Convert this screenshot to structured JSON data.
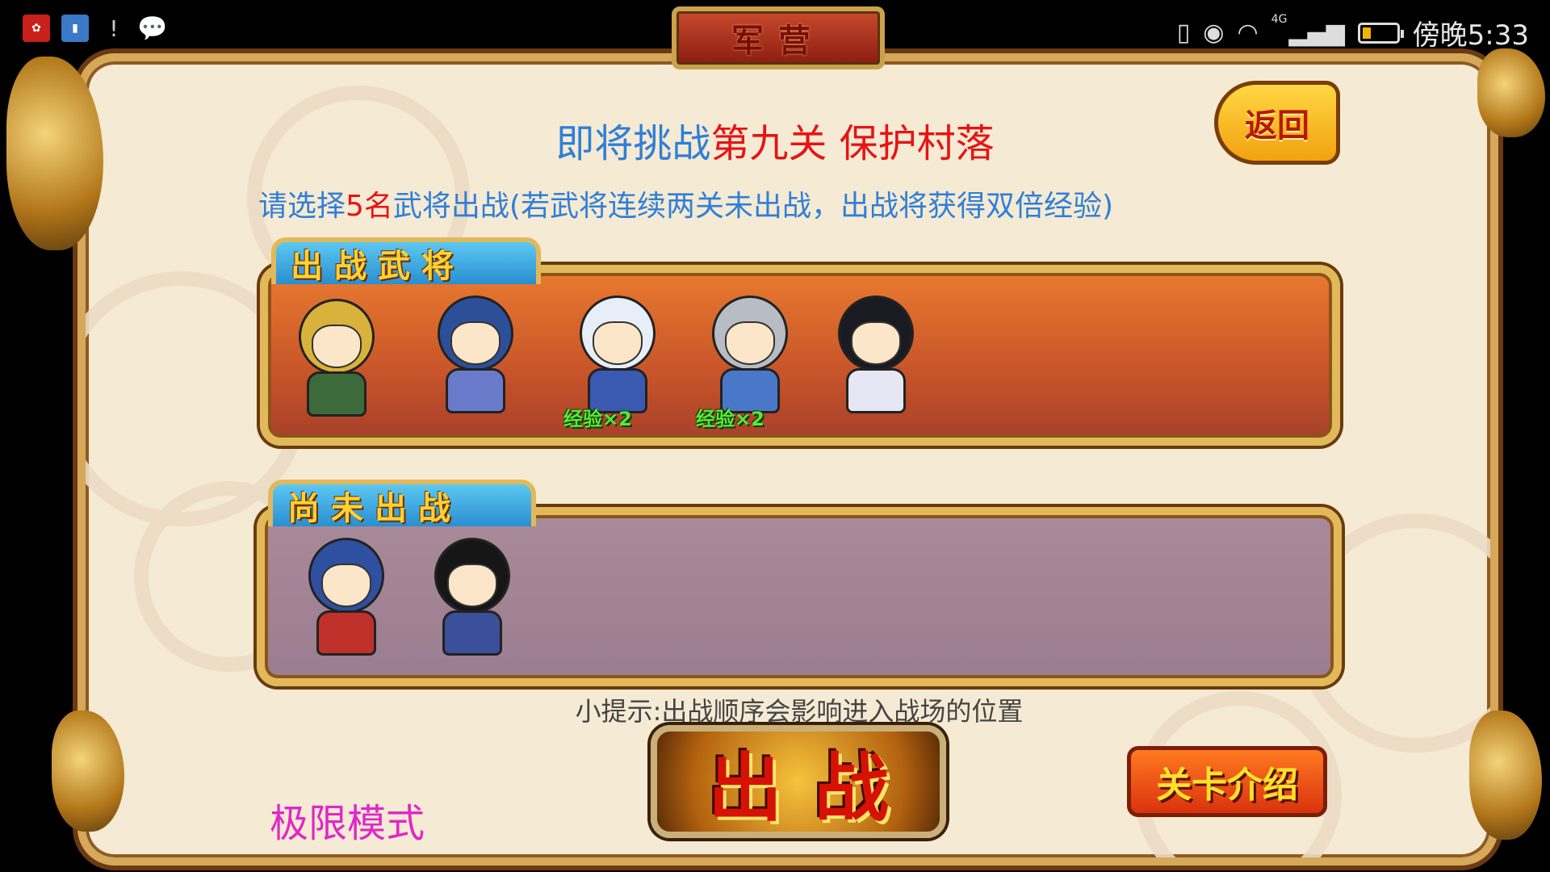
{
  "status_bar": {
    "left_icons": [
      "huawei-icon",
      "book-icon",
      "alert-icon",
      "chat-icon"
    ],
    "right_icons": [
      "vibrate-icon",
      "eye-icon",
      "wifi-icon",
      "signal-icon"
    ],
    "network": "4G",
    "battery_level": 0.25,
    "time": "傍晚5:33"
  },
  "title_plaque": "军营",
  "back_button": "返回",
  "headline": {
    "prefix": "即将挑战",
    "stage": "第九关 保护村落"
  },
  "instruction": {
    "prefix": "请选择",
    "count": "5名",
    "suffix": "武将出战(若武将连续两关未出战，出战将获得双倍经验)"
  },
  "deployed_section": {
    "tab_label": "出战武将",
    "heroes": [
      {
        "name": "golden-helmet-general",
        "exp_badge": ""
      },
      {
        "name": "blue-bearded-general",
        "exp_badge": ""
      },
      {
        "name": "white-plume-general",
        "exp_badge": "经验×2"
      },
      {
        "name": "silver-helm-strategist",
        "exp_badge": "经验×2"
      },
      {
        "name": "lady-strategist",
        "exp_badge": ""
      }
    ]
  },
  "reserve_section": {
    "tab_label": "尚未出战",
    "heroes": [
      {
        "name": "spear-warrior"
      },
      {
        "name": "black-haired-scholar"
      }
    ]
  },
  "hint": "小提示:出战顺序会影响进入战场的位置",
  "fight_button": "出战",
  "stage_intro_button": "关卡介绍",
  "mode_label": "极限模式",
  "colors": {
    "headline_blue": "#2f7fd8",
    "highlight_red": "#e61414",
    "exp_green": "#59e83a",
    "mode_magenta": "#e028c8"
  }
}
